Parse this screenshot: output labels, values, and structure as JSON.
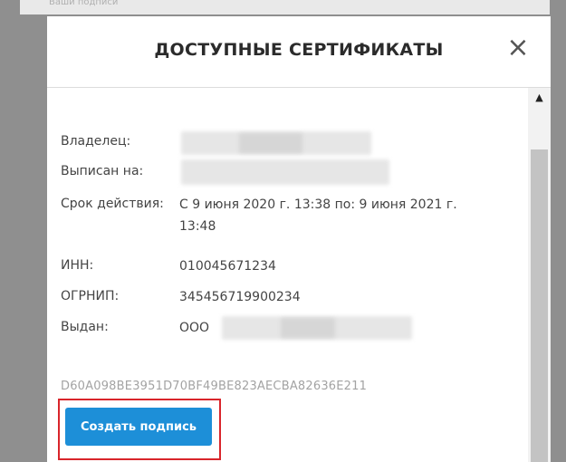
{
  "background": {
    "header_text": "Ваши подписи"
  },
  "modal": {
    "title": "ДОСТУПНЫЕ СЕРТИФИКАТЫ",
    "close_icon": "×"
  },
  "certificate": {
    "owner_label": "Владелец:",
    "issued_to_label": "Выписан на:",
    "validity_label": "Срок действия:",
    "validity_value_line1": "С 9 июня 2020 г. 13:38 по: 9 июня 2021 г.",
    "validity_value_line2": "13:48",
    "inn_label": "ИНН:",
    "inn_value": "010045671234",
    "ogrnip_label": "ОГРНИП:",
    "ogrnip_value": "345456719900234",
    "issuer_label": "Выдан:",
    "issuer_value": "ООО",
    "thumbprint": "D60A098BE3951D70BF49BE823AECBA82636E211"
  },
  "actions": {
    "create_signature_label": "Создать подпись"
  },
  "scrollbar": {
    "up_icon": "▲"
  },
  "colors": {
    "accent": "#1d8fd8",
    "highlight": "#d9252b"
  }
}
